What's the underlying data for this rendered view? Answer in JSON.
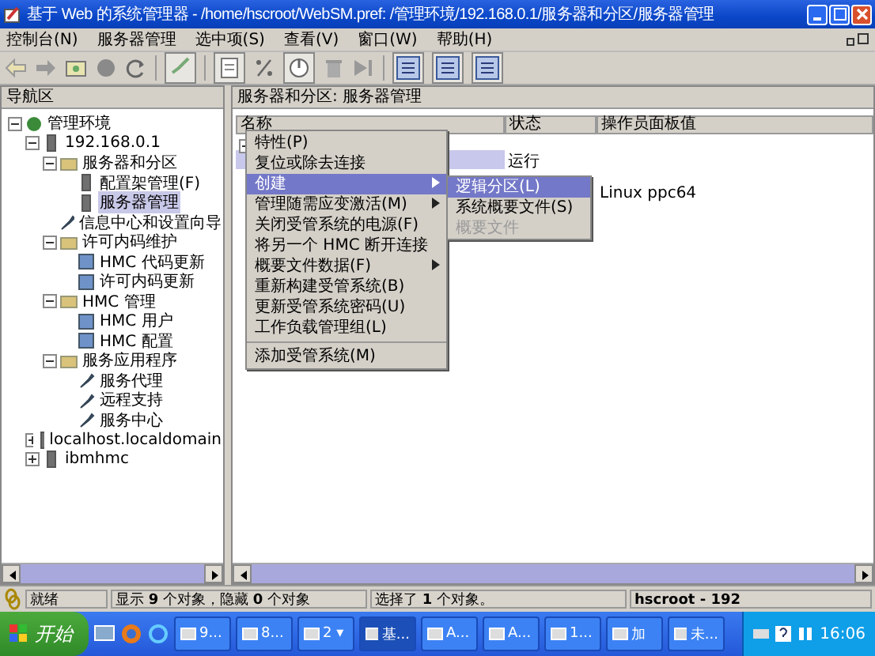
{
  "window": {
    "title": "基于 Web 的系统管理器 - /home/hscroot/WebSM.pref: /管理环境/192.168.0.1/服务器和分区/服务器管理"
  },
  "menu": [
    "控制台(N)",
    "服务器管理",
    "选中项(S)",
    "查看(V)",
    "窗口(W)",
    "帮助(H)"
  ],
  "navigation": {
    "title": "导航区",
    "tree": [
      {
        "label": "管理环境",
        "kind": "globe",
        "expanded": true,
        "selected": false,
        "children": [
          {
            "label": "192.168.0.1",
            "kind": "server",
            "expanded": true,
            "selected": false,
            "children": [
              {
                "label": "服务器和分区",
                "kind": "folder",
                "expanded": true,
                "selected": false,
                "children": [
                  {
                    "label": "配置架管理(F)",
                    "kind": "server",
                    "selected": false
                  },
                  {
                    "label": "服务器管理",
                    "kind": "server",
                    "selected": true
                  }
                ]
              },
              {
                "label": "信息中心和设置向导",
                "kind": "tool",
                "selected": false
              },
              {
                "label": "许可内码维护",
                "kind": "folder",
                "expanded": true,
                "selected": false,
                "children": [
                  {
                    "label": "HMC 代码更新",
                    "kind": "page",
                    "selected": false
                  },
                  {
                    "label": "许可内码更新",
                    "kind": "page",
                    "selected": false
                  }
                ]
              },
              {
                "label": "HMC 管理",
                "kind": "folder",
                "expanded": true,
                "selected": false,
                "children": [
                  {
                    "label": "HMC 用户",
                    "kind": "page",
                    "selected": false
                  },
                  {
                    "label": "HMC 配置",
                    "kind": "page",
                    "selected": false
                  }
                ]
              },
              {
                "label": "服务应用程序",
                "kind": "folder",
                "expanded": true,
                "selected": false,
                "children": [
                  {
                    "label": "服务代理",
                    "kind": "tool",
                    "selected": false
                  },
                  {
                    "label": "远程支持",
                    "kind": "tool",
                    "selected": false
                  },
                  {
                    "label": "服务中心",
                    "kind": "tool",
                    "selected": false
                  }
                ]
              }
            ]
          },
          {
            "label": "localhost.localdomain",
            "kind": "server",
            "expanded": false,
            "selected": false
          },
          {
            "label": "ibmhmc",
            "kind": "server",
            "expanded": false,
            "selected": false
          }
        ]
      }
    ]
  },
  "content": {
    "title": "服务器和分区: 服务器管理",
    "columns": [
      "名称",
      "状态",
      "操作员面板值"
    ],
    "rows": [
      {
        "status": "运行",
        "selected": true
      },
      {
        "panel": "Linux ppc64",
        "selected": false
      }
    ],
    "context_menu": [
      {
        "label": "特性(P)",
        "selected": false,
        "submenu": false
      },
      {
        "label": "复位或除去连接",
        "selected": false,
        "submenu": false
      },
      {
        "label": "创建",
        "selected": true,
        "submenu": true
      },
      {
        "label": "管理随需应变激活(M)",
        "selected": false,
        "submenu": true
      },
      {
        "label": "关闭受管系统的电源(F)",
        "selected": false,
        "submenu": false
      },
      {
        "label": "将另一个 HMC 断开连接",
        "selected": false,
        "submenu": false
      },
      {
        "label": "概要文件数据(F)",
        "selected": false,
        "submenu": true
      },
      {
        "label": "重新构建受管系统(B)",
        "selected": false,
        "submenu": false
      },
      {
        "label": "更新受管系统密码(U)",
        "selected": false,
        "submenu": false
      },
      {
        "label": "工作负载管理组(L)",
        "selected": false,
        "submenu": false
      },
      {
        "label": "添加受管系统(M)",
        "selected": false,
        "submenu": false,
        "separator_before": true
      }
    ],
    "submenu": [
      {
        "label": "逻辑分区(L)",
        "selected": true,
        "disabled": false
      },
      {
        "label": "系统概要文件(S)",
        "selected": false,
        "disabled": false
      },
      {
        "label": "概要文件",
        "selected": false,
        "disabled": true
      }
    ]
  },
  "status_bar": {
    "ready": "就绪",
    "shown": "显示 **9** 个对象，隐藏 **0** 个对象",
    "selection": "选择了 **1** 个对象。",
    "user": "hscroot - 192"
  },
  "taskbar": {
    "start": "开始",
    "tasks": [
      {
        "label": "9...",
        "selected": false
      },
      {
        "label": "8...",
        "selected": false
      },
      {
        "label": "2 ▾",
        "selected": false
      },
      {
        "label": "基...",
        "selected": true
      },
      {
        "label": "A...",
        "selected": false
      },
      {
        "label": "A...",
        "selected": false
      },
      {
        "label": "1...",
        "selected": false
      },
      {
        "label": "加",
        "selected": false
      },
      {
        "label": "未...",
        "selected": false
      }
    ],
    "clock": "16:06"
  }
}
